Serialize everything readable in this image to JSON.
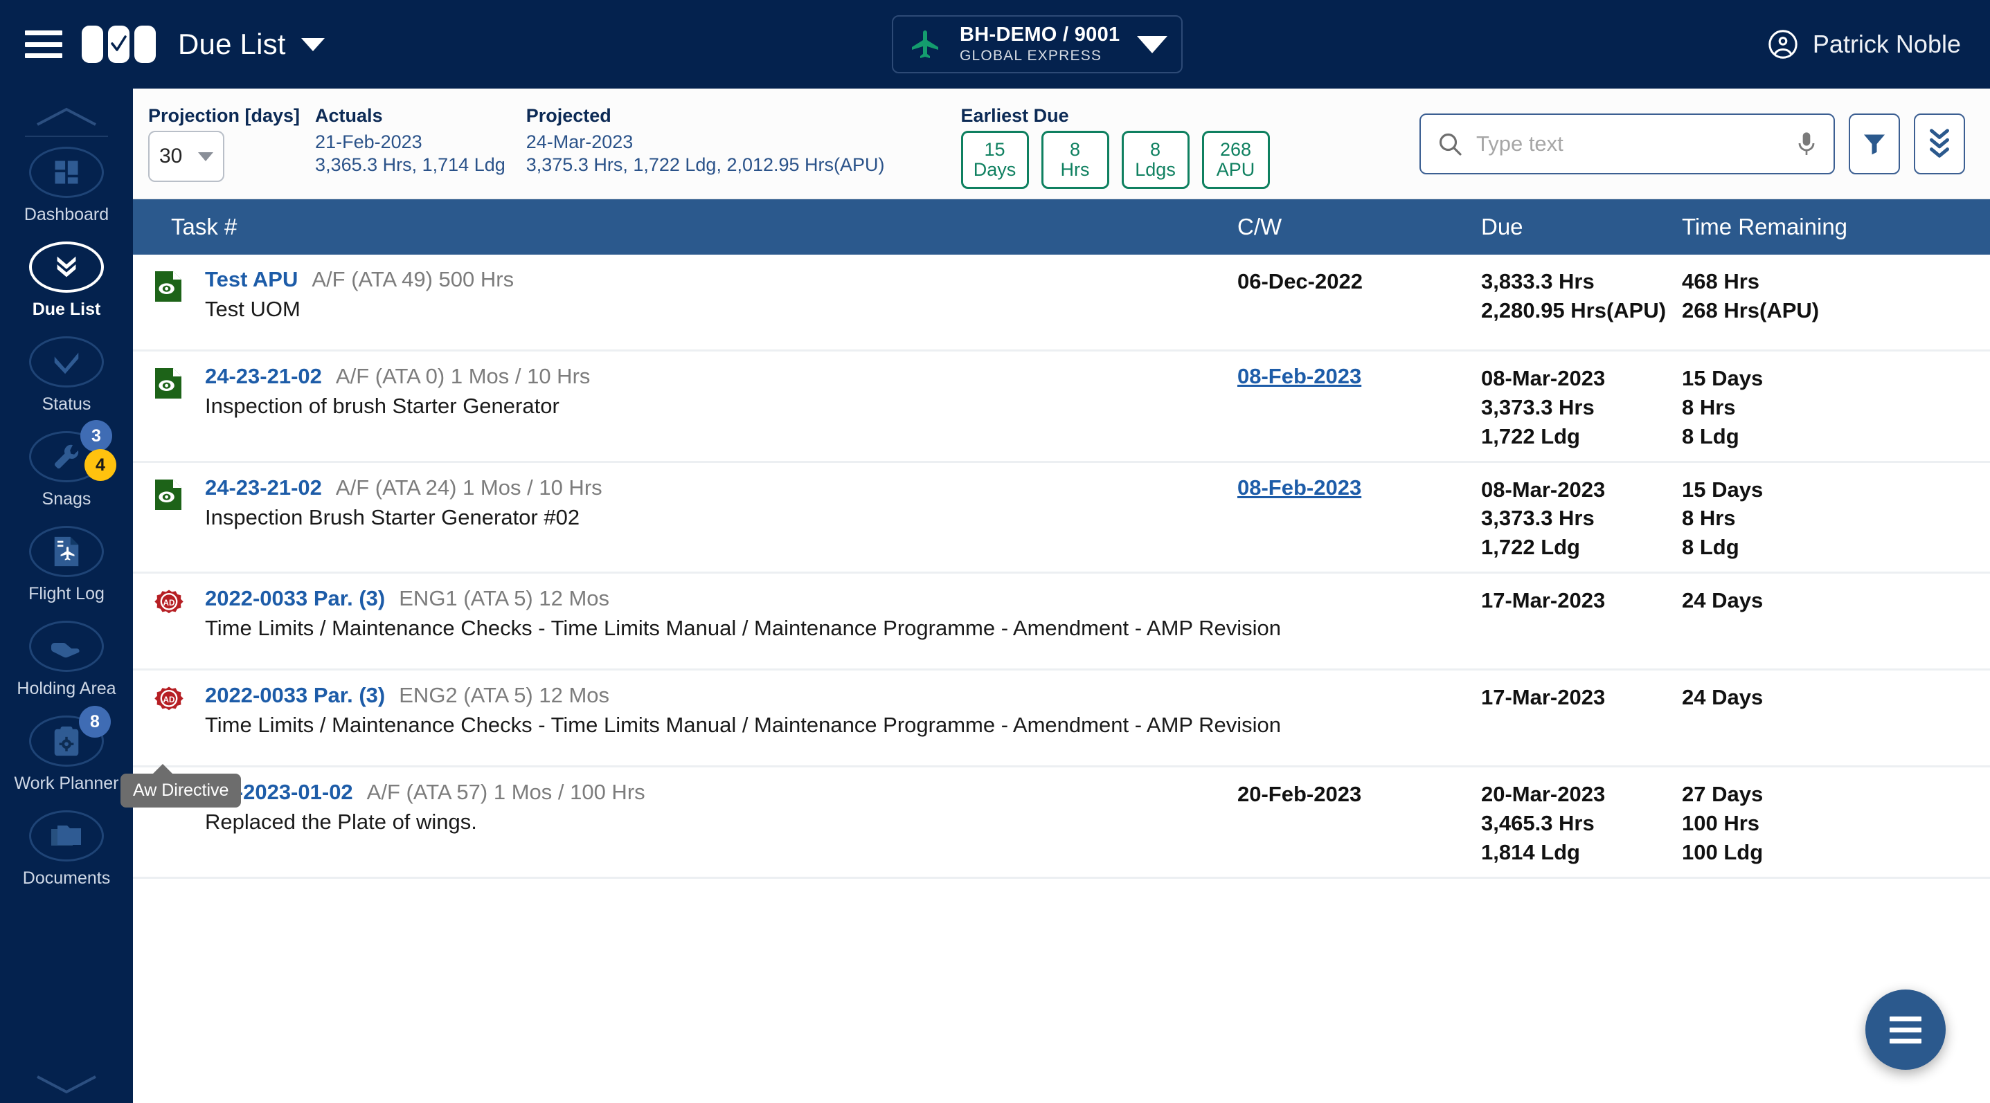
{
  "topbar": {
    "menu_icon": "hamburger-icon",
    "logo_icon": "checkbox-logo-icon",
    "title": "Due List",
    "title_caret_icon": "chevron-down-icon",
    "aircraft": {
      "plane_icon": "airplane-icon",
      "registration": "BH-DEMO / 9001",
      "model": "GLOBAL EXPRESS",
      "caret_icon": "chevron-down-icon"
    },
    "user": {
      "avatar_icon": "account-circle-icon",
      "name": "Patrick Noble"
    }
  },
  "sidebar": {
    "scroll_up_icon": "chevron-up-icon",
    "scroll_down_icon": "chevron-down-icon",
    "items": [
      {
        "label": "Dashboard",
        "icon": "dashboard-grid-icon",
        "active": false
      },
      {
        "label": "Due List",
        "icon": "double-chevron-down-icon",
        "active": true
      },
      {
        "label": "Status",
        "icon": "check-circle-icon",
        "active": false
      },
      {
        "label": "Snags",
        "icon": "wrench-icon",
        "active": false,
        "badges": [
          "3",
          "4"
        ]
      },
      {
        "label": "Flight Log",
        "icon": "flight-log-icon",
        "active": false
      },
      {
        "label": "Holding Area",
        "icon": "hand-hold-icon",
        "active": false
      },
      {
        "label": "Work Planner",
        "icon": "clipboard-gear-icon",
        "active": false,
        "badges": [
          "8"
        ]
      },
      {
        "label": "Documents",
        "icon": "folders-icon",
        "active": false
      }
    ],
    "tooltip": "Aw Directive"
  },
  "filterbar": {
    "projection_label": "Projection [days]",
    "projection_value": "30",
    "projection_caret_icon": "chevron-down-icon",
    "actuals_label": "Actuals",
    "actuals_date": "21-Feb-2023",
    "actuals_values": "3,365.3 Hrs, 1,714 Ldg",
    "projected_label": "Projected",
    "projected_date": "24-Mar-2023",
    "projected_values": "3,375.3 Hrs, 1,722 Ldg, 2,012.95 Hrs(APU)",
    "earliest_due_label": "Earliest Due",
    "chips": [
      {
        "value": "15",
        "unit": "Days"
      },
      {
        "value": "8",
        "unit": "Hrs"
      },
      {
        "value": "8",
        "unit": "Ldgs"
      },
      {
        "value": "268",
        "unit": "APU"
      }
    ],
    "search_placeholder": "Type text",
    "search_value": "",
    "search_icon": "search-icon",
    "mic_icon": "microphone-icon",
    "filter_icon": "funnel-filter-icon",
    "expand_icon": "triple-chevron-down-icon"
  },
  "table": {
    "headers": {
      "task": "Task #",
      "cw": "C/W",
      "due": "Due",
      "remaining": "Time Remaining"
    },
    "rows": [
      {
        "icon": "green-inspection-doc-icon",
        "task_no": "Test APU",
        "task_meta": "A/F (ATA 49) 500 Hrs",
        "task_desc": "Test UOM",
        "cw": "06-Dec-2022",
        "cw_link": false,
        "due": "3,833.3 Hrs\n2,280.95 Hrs(APU)",
        "remaining": "468 Hrs\n268 Hrs(APU)"
      },
      {
        "icon": "green-inspection-doc-icon",
        "task_no": "24-23-21-02",
        "task_meta": "A/F (ATA 0) 1 Mos / 10 Hrs",
        "task_desc": "Inspection of brush Starter Generator",
        "cw": "08-Feb-2023",
        "cw_link": true,
        "due": "08-Mar-2023\n3,373.3 Hrs\n1,722 Ldg",
        "remaining": "15 Days\n8 Hrs\n8 Ldg"
      },
      {
        "icon": "green-inspection-doc-icon",
        "task_no": "24-23-21-02",
        "task_meta": "A/F (ATA 24) 1 Mos / 10 Hrs",
        "task_desc": "Inspection Brush Starter Generator #02",
        "cw": "08-Feb-2023",
        "cw_link": true,
        "due": "08-Mar-2023\n3,373.3 Hrs\n1,722 Ldg",
        "remaining": "15 Days\n8 Hrs\n8 Ldg"
      },
      {
        "icon": "red-ad-seal-icon",
        "task_no": "2022-0033 Par. (3)",
        "task_meta": "ENG1 (ATA 5) 12 Mos",
        "task_desc": "Time Limits / Maintenance Checks - Time Limits Manual / Maintenance Programme - Amendment - AMP Revision",
        "cw": "",
        "cw_link": false,
        "due": "17-Mar-2023",
        "remaining": "24 Days"
      },
      {
        "icon": "red-ad-seal-icon",
        "task_no": "2022-0033 Par. (3)",
        "task_meta": "ENG2 (ATA 5) 12 Mos",
        "task_desc": "Time Limits / Maintenance Checks - Time Limits Manual / Maintenance Programme - Amendment - AMP Revision",
        "cw": "",
        "cw_link": false,
        "due": "17-Mar-2023",
        "remaining": "24 Days"
      },
      {
        "icon": "red-ad-seal-icon",
        "task_no": "AD-2023-01-02",
        "task_meta": "A/F (ATA 57) 1 Mos / 100 Hrs",
        "task_desc": "Replaced the Plate of wings.",
        "cw": "20-Feb-2023",
        "cw_link": false,
        "due": "20-Mar-2023\n3,465.3 Hrs\n1,814 Ldg",
        "remaining": "27 Days\n100 Hrs\n100 Ldg"
      }
    ]
  },
  "fab": {
    "icon": "menu-lines-icon"
  },
  "colors": {
    "navy": "#04224e",
    "header_blue": "#2b598d",
    "link_blue": "#1d5ca8",
    "green": "#0f8060",
    "red": "#b61f24",
    "yellow": "#ffc20e"
  }
}
